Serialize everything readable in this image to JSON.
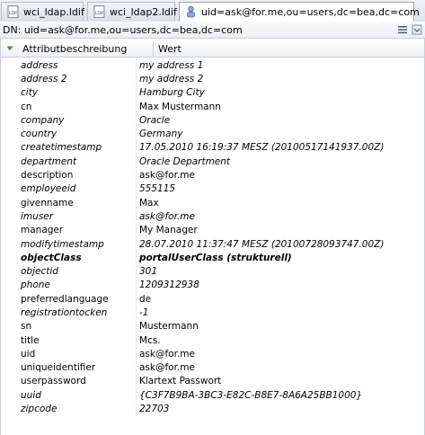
{
  "tabs": [
    {
      "label": "wci_ldap.ldif",
      "icon": "ldif-file-icon",
      "active": false
    },
    {
      "label": "wci_ldap2.ldif",
      "icon": "ldif-file-icon",
      "active": false
    },
    {
      "label": "uid=ask@for.me,ou=users,dc=bea,dc=com",
      "icon": "ldap-entry-icon",
      "active": true,
      "close": "✕"
    }
  ],
  "dn": {
    "text": "DN: uid=ask@for.me,ou=users,dc=bea,dc=com"
  },
  "table": {
    "col_attr": "Attributbeschreibung",
    "col_val": "Wert",
    "rows": [
      {
        "attr": "address",
        "val": "my address 1",
        "style": "italic"
      },
      {
        "attr": "address 2",
        "val": "my address 2",
        "style": "italic"
      },
      {
        "attr": "city",
        "val": "Hamburg City",
        "style": "italic"
      },
      {
        "attr": "cn",
        "val": "Max Mustermann",
        "style": "normal"
      },
      {
        "attr": "company",
        "val": "Oracle",
        "style": "italic"
      },
      {
        "attr": "country",
        "val": "Germany",
        "style": "italic"
      },
      {
        "attr": "createtimestamp",
        "val": "17.05.2010 16:19:37 MESZ (20100517141937.00Z)",
        "style": "italic"
      },
      {
        "attr": "department",
        "val": "Oracle Department",
        "style": "italic"
      },
      {
        "attr": "description",
        "val": "ask@for.me",
        "style": "normal"
      },
      {
        "attr": "employeeid",
        "val": "555115",
        "style": "italic"
      },
      {
        "attr": "givenname",
        "val": "Max",
        "style": "normal"
      },
      {
        "attr": "imuser",
        "val": "ask@for.me",
        "style": "italic"
      },
      {
        "attr": "manager",
        "val": "My Manager",
        "style": "normal"
      },
      {
        "attr": "modifytimestamp",
        "val": "28.07.2010 11:37:47 MESZ (20100728093747.00Z)",
        "style": "italic"
      },
      {
        "attr": "objectClass",
        "val": "portalUserClass (strukturell)",
        "style": "bold"
      },
      {
        "attr": "objectid",
        "val": "301",
        "style": "italic"
      },
      {
        "attr": "phone",
        "val": "1209312938",
        "style": "italic"
      },
      {
        "attr": "preferredlanguage",
        "val": "de",
        "style": "normal"
      },
      {
        "attr": "registrationtocken",
        "val": "-1",
        "style": "italic"
      },
      {
        "attr": "sn",
        "val": "Mustermann",
        "style": "normal"
      },
      {
        "attr": "title",
        "val": "Mcs.",
        "style": "normal"
      },
      {
        "attr": "uid",
        "val": "ask@for.me",
        "style": "normal"
      },
      {
        "attr": "uniqueidentifier",
        "val": "ask@for.me",
        "style": "normal"
      },
      {
        "attr": "userpassword",
        "val": "Klartext Passwort",
        "style": "normal"
      },
      {
        "attr": "uuid",
        "val": "{C3F7B9BA-3BC3-E82C-B8E7-8A6A25BB1000}",
        "style": "italic"
      },
      {
        "attr": "zipcode",
        "val": "22703",
        "style": "italic"
      }
    ]
  }
}
